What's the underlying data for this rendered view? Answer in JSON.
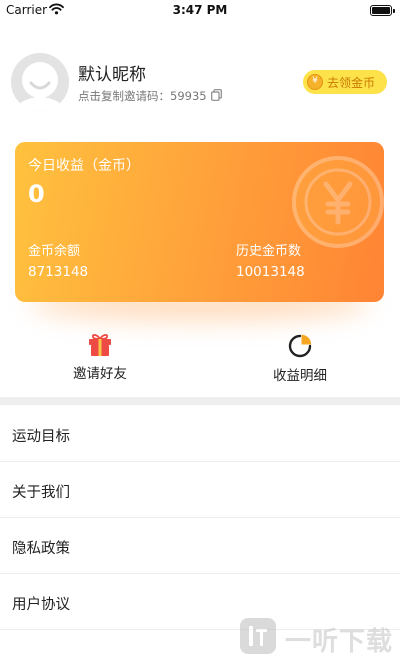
{
  "status_bar": {
    "carrier": "Carrier",
    "time": "3:47 PM"
  },
  "profile": {
    "nickname": "默认昵称",
    "invite_line": "点击复制邀请码：59935",
    "coin_button_icon": "¥",
    "coin_button_label": "去领金币"
  },
  "earnings_card": {
    "today_label": "今日收益（金币）",
    "today_value": "0",
    "balance_label": "金币余额",
    "balance_value": "8713148",
    "history_label": "历史金币数",
    "history_value": "10013148",
    "gradient_colors": [
      "#ffc23e",
      "#ffa53b",
      "#ff8434"
    ]
  },
  "actions": [
    {
      "label": "邀请好友",
      "icon": "gift-icon"
    },
    {
      "label": "收益明细",
      "icon": "pie-chart-icon"
    }
  ],
  "menu": [
    {
      "label": "运动目标"
    },
    {
      "label": "关于我们"
    },
    {
      "label": "隐私政策"
    },
    {
      "label": "用户协议"
    }
  ],
  "watermark": {
    "text": "一听下载"
  },
  "colors": {
    "accent_yellow": "#fde24a",
    "accent_text": "#c97a00",
    "gift_red": "#ee4b44"
  }
}
